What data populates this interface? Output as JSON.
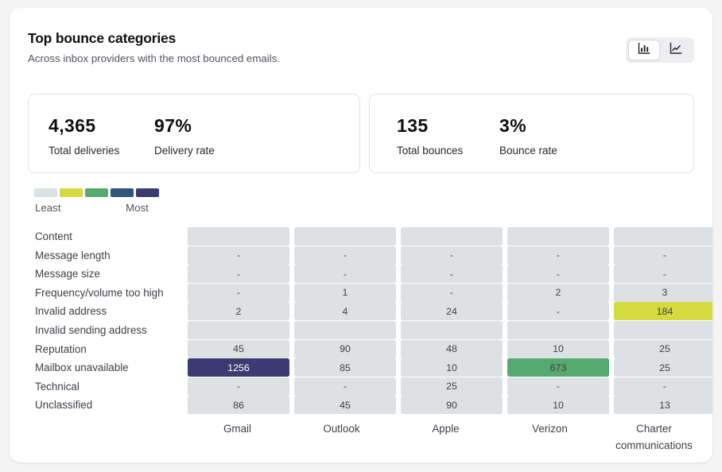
{
  "header": {
    "title": "Top bounce categories",
    "subtitle": "Across inbox providers with the most bounced emails.",
    "toggles": [
      {
        "name": "bar-chart-view",
        "label": "Bar chart view",
        "active": true
      },
      {
        "name": "line-chart-view",
        "label": "Line chart view",
        "active": false
      }
    ]
  },
  "stats": {
    "deliveries_card": [
      {
        "value": "4,365",
        "label": "Total deliveries"
      },
      {
        "value": "97%",
        "label": "Delivery rate"
      }
    ],
    "bounces_card": [
      {
        "value": "135",
        "label": "Total bounces"
      },
      {
        "value": "3%",
        "label": "Bounce rate"
      }
    ]
  },
  "legend": {
    "least_label": "Least",
    "most_label": "Most",
    "colors": [
      "#dde1e3",
      "#d4db3e",
      "#56a96f",
      "#2f5579",
      "#3b3b72"
    ]
  },
  "chart_data": {
    "type": "heatmap",
    "title": "Top bounce categories",
    "subtitle": "Across inbox providers with the most bounced emails.",
    "xlabel": "",
    "ylabel": "",
    "legend_position": "top-left",
    "scale_labels": [
      "Least",
      "Most"
    ],
    "scale_colors": [
      "#dde1e3",
      "#d4db3e",
      "#56a96f",
      "#2f5579",
      "#3b3b72"
    ],
    "empty_value": "-",
    "columns": [
      "Gmail",
      "Outlook",
      "Apple",
      "Verizon",
      "Charter communications"
    ],
    "rows": [
      "Content",
      "Message length",
      "Message size",
      "Frequency/volume too high",
      "Invalid address",
      "Invalid sending address",
      "Reputation",
      "Mailbox unavailable",
      "Technical",
      "Unclassified"
    ],
    "cells": [
      [
        {
          "value": "",
          "color": "#dde1e3",
          "light": false
        },
        {
          "value": "",
          "color": "#dde1e3",
          "light": false
        },
        {
          "value": "",
          "color": "#dde1e3",
          "light": false
        },
        {
          "value": "",
          "color": "#dde1e3",
          "light": false
        },
        {
          "value": "",
          "color": "#dde1e3",
          "light": false
        }
      ],
      [
        {
          "value": "-",
          "color": "#dde1e3",
          "light": false
        },
        {
          "value": "-",
          "color": "#dde1e3",
          "light": false
        },
        {
          "value": "-",
          "color": "#dde1e3",
          "light": false
        },
        {
          "value": "-",
          "color": "#dde1e3",
          "light": false
        },
        {
          "value": "-",
          "color": "#dde1e3",
          "light": false
        }
      ],
      [
        {
          "value": "-",
          "color": "#dde1e3",
          "light": false
        },
        {
          "value": "-",
          "color": "#dde1e3",
          "light": false
        },
        {
          "value": "-",
          "color": "#dde1e3",
          "light": false
        },
        {
          "value": "-",
          "color": "#dde1e3",
          "light": false
        },
        {
          "value": "-",
          "color": "#dde1e3",
          "light": false
        }
      ],
      [
        {
          "value": "-",
          "color": "#dde1e3",
          "light": false
        },
        {
          "value": "1",
          "color": "#dde1e3",
          "light": false
        },
        {
          "value": "-",
          "color": "#dde1e3",
          "light": false
        },
        {
          "value": "2",
          "color": "#dde1e3",
          "light": false
        },
        {
          "value": "3",
          "color": "#dde1e3",
          "light": false
        }
      ],
      [
        {
          "value": "2",
          "color": "#dde1e3",
          "light": false
        },
        {
          "value": "4",
          "color": "#dde1e3",
          "light": false
        },
        {
          "value": "24",
          "color": "#dde1e3",
          "light": false
        },
        {
          "value": "-",
          "color": "#dde1e3",
          "light": false
        },
        {
          "value": "184",
          "color": "#d4db3e",
          "light": false
        }
      ],
      [
        {
          "value": "",
          "color": "#dde1e3",
          "light": false
        },
        {
          "value": "",
          "color": "#dde1e3",
          "light": false
        },
        {
          "value": "",
          "color": "#dde1e3",
          "light": false
        },
        {
          "value": "",
          "color": "#dde1e3",
          "light": false
        },
        {
          "value": "",
          "color": "#dde1e3",
          "light": false
        }
      ],
      [
        {
          "value": "45",
          "color": "#dde1e3",
          "light": false
        },
        {
          "value": "90",
          "color": "#dde1e3",
          "light": false
        },
        {
          "value": "48",
          "color": "#dde1e3",
          "light": false
        },
        {
          "value": "10",
          "color": "#dde1e3",
          "light": false
        },
        {
          "value": "25",
          "color": "#dde1e3",
          "light": false
        }
      ],
      [
        {
          "value": "1256",
          "color": "#3b3b72",
          "light": true
        },
        {
          "value": "85",
          "color": "#dde1e3",
          "light": false
        },
        {
          "value": "10",
          "color": "#dde1e3",
          "light": false
        },
        {
          "value": "673",
          "color": "#56a96f",
          "light": false
        },
        {
          "value": "25",
          "color": "#dde1e3",
          "light": false
        }
      ],
      [
        {
          "value": "-",
          "color": "#dde1e3",
          "light": false
        },
        {
          "value": "-",
          "color": "#dde1e3",
          "light": false
        },
        {
          "value": "25",
          "color": "#dde1e3",
          "light": false
        },
        {
          "value": "-",
          "color": "#dde1e3",
          "light": false
        },
        {
          "value": "-",
          "color": "#dde1e3",
          "light": false
        }
      ],
      [
        {
          "value": "86",
          "color": "#dde1e3",
          "light": false
        },
        {
          "value": "45",
          "color": "#dde1e3",
          "light": false
        },
        {
          "value": "90",
          "color": "#dde1e3",
          "light": false
        },
        {
          "value": "10",
          "color": "#dde1e3",
          "light": false
        },
        {
          "value": "13",
          "color": "#dde1e3",
          "light": false
        }
      ]
    ]
  }
}
